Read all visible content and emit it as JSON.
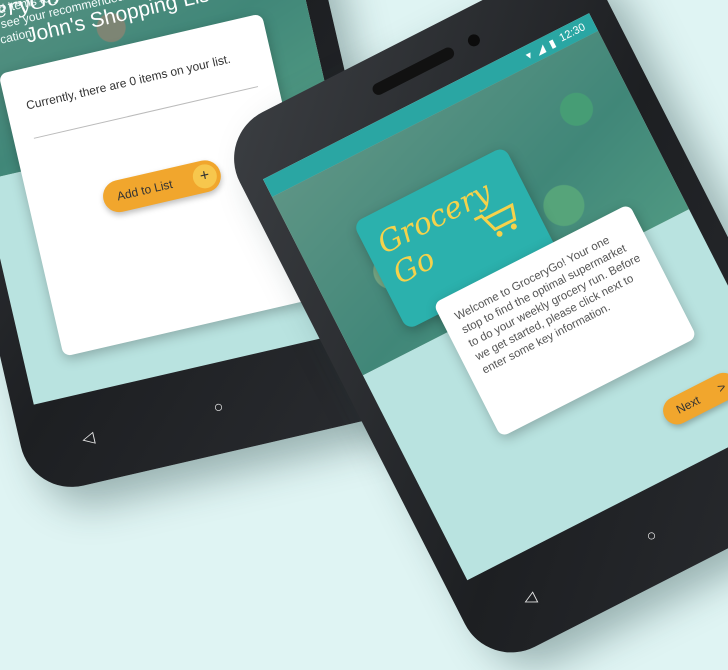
{
  "left_phone": {
    "brand": "roceryGo",
    "hint": "Add items to your list and click 'Finalize' to see your recommended shopping location!",
    "list_title": "John's Shopping List:",
    "item_count_text": "Currently, there are 0 items on your list.",
    "add_button_label": "Add to List",
    "add_button_icon": "+",
    "nav": {
      "back": "◁",
      "home": "○",
      "recents": "□"
    }
  },
  "right_phone": {
    "status": {
      "time": "12:30"
    },
    "logo_text_line1": "Grocery",
    "logo_text_line2": "Go",
    "welcome_text": "Welcome to GroceryGo! Your one stop to find the optimal supermarket to do your weekly grocery run. Before we get started, please click next to enter some key information.",
    "next_button_label": "Next",
    "next_arrow": ">",
    "nav": {
      "back": "◁",
      "home": "○",
      "recents": "□"
    }
  },
  "colors": {
    "accent": "#f1a62d",
    "teal": "#2aa6a3",
    "background": "#dff4f3"
  }
}
